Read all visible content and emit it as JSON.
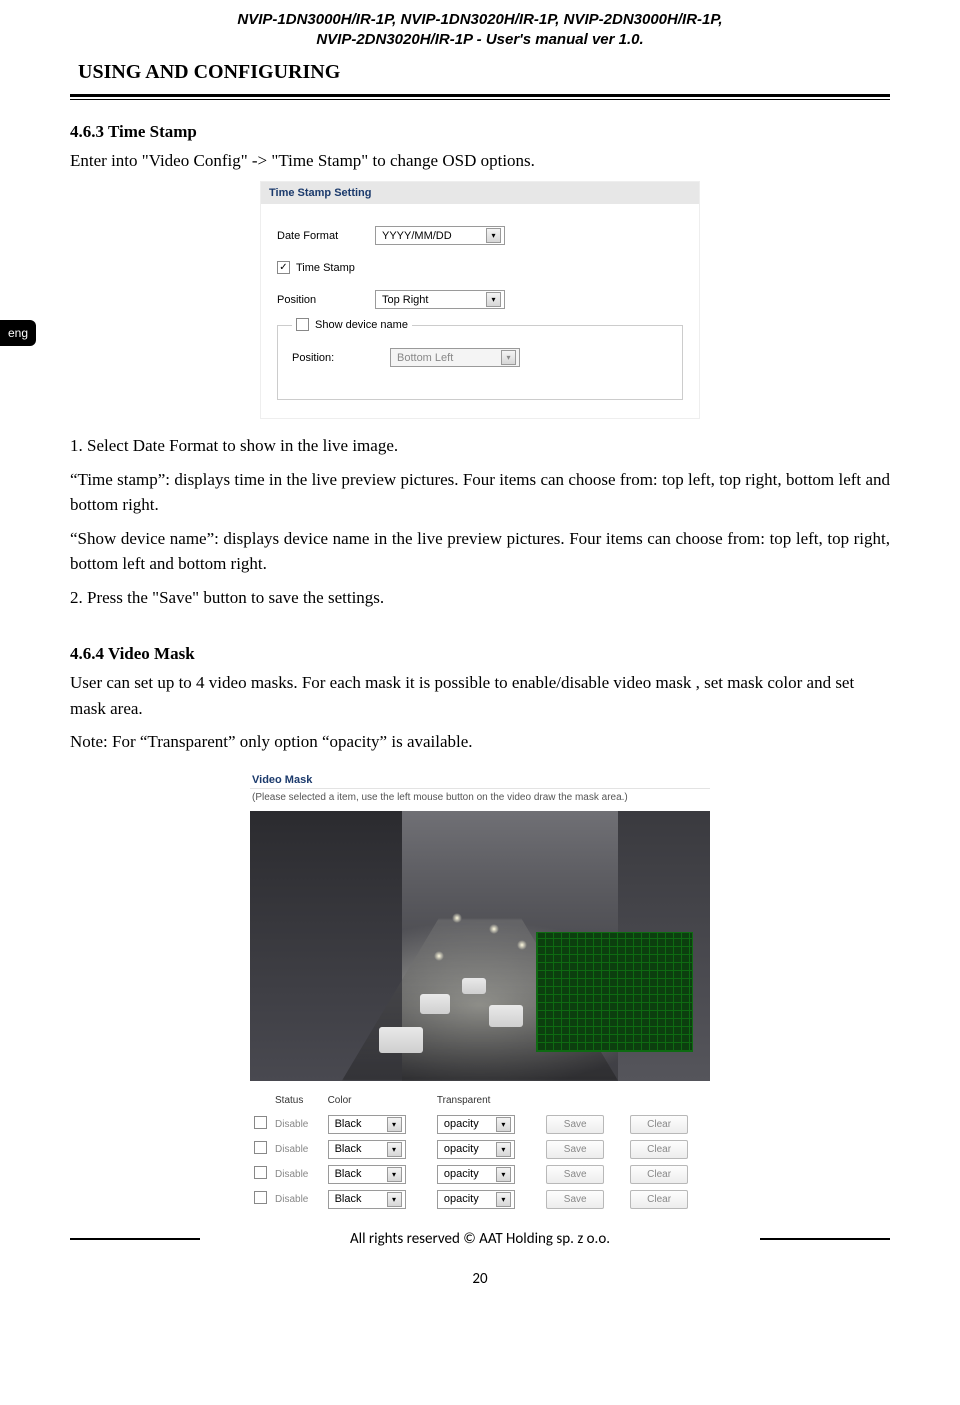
{
  "doc_header": {
    "line1": "NVIP-1DN3000H/IR-1P, NVIP-1DN3020H/IR-1P, NVIP-2DN3000H/IR-1P,",
    "line2": "NVIP-2DN3020H/IR-1P - User's manual ver 1.0."
  },
  "section_title": "USING AND CONFIGURING",
  "lang_tab": "eng",
  "sec463": {
    "heading": "4.6.3 Time Stamp",
    "intro": "Enter into \"Video Config\" -> \"Time Stamp\" to change OSD options.",
    "para1": "1. Select Date Format to show in the live image.",
    "para2": "“Time stamp”: displays time in the live preview pictures. Four items can choose from: top left, top right, bottom left and bottom right.",
    "para3": "“Show device name”: displays device name in the live preview pictures. Four items can choose from: top left, top right, bottom left and bottom right.",
    "para4": "2. Press the \"Save\" button to save the settings."
  },
  "ts_panel": {
    "title": "Time Stamp Setting",
    "date_format_label": "Date Format",
    "date_format_value": "YYYY/MM/DD",
    "timestamp_chk": "Time Stamp",
    "timestamp_checked": "✓",
    "position_label": "Position",
    "position_value": "Top Right",
    "showdevice_chk": "Show device name",
    "position2_label": "Position:",
    "position2_value": "Bottom Left"
  },
  "sec464": {
    "heading": "4.6.4 Video Mask",
    "para1": "User can set up to 4 video masks. For each mask it is possible to enable/disable video mask , set mask color and set mask area.",
    "para2": "Note: For “Transparent” only option “opacity” is available."
  },
  "vm_panel": {
    "title": "Video Mask",
    "note": "(Please selected a item, use the left mouse button on the video draw the mask area.)",
    "headers": {
      "status": "Status",
      "color": "Color",
      "transparent": "Transparent"
    },
    "row": {
      "status": "Disable",
      "color": "Black",
      "transparent": "opacity",
      "save": "Save",
      "clear": "Clear"
    },
    "rows_count": 4
  },
  "footer": {
    "rights": "All rights reserved © AAT Holding sp. z o.o.",
    "page": "20"
  }
}
